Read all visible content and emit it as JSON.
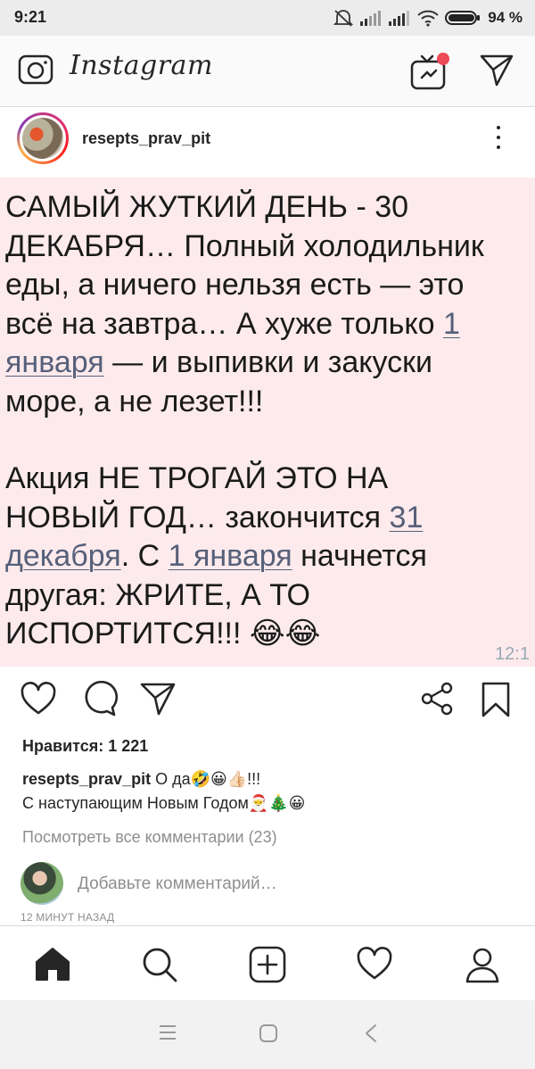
{
  "status_bar": {
    "time": "9:21",
    "battery_percent": "94 %"
  },
  "app": {
    "title": "Instagram"
  },
  "post": {
    "username": "resepts_prav_pit",
    "image_text": {
      "line1": "САМЫЙ ЖУТКИЙ ДЕНЬ - 30",
      "line2": "ДЕКАБРЯ… Полный холодильник",
      "line3": "еды, а ничего нельзя есть — это",
      "line4a": "всё на завтра… А хуже только ",
      "link1a": "1",
      "link1b": "января",
      "line5b": " — и выпивки и закуски",
      "line6": "море, а не лезет!!!",
      "line7": "Акция НЕ ТРОГАЙ ЭТО НА",
      "line8a": "НОВЫЙ ГОД… закончится ",
      "link2a": "31",
      "link2b": "декабря",
      "line9b": ". С ",
      "link3": "1 января",
      "line9c": " начнется",
      "line10": "другая: ЖРИТЕ, А ТО",
      "line11": "ИСПОРТИТСЯ!!! 😂😂",
      "timestamp": "12:1"
    },
    "likes": "Нравится: 1 221",
    "caption_user": "resepts_prav_pit",
    "caption_line1": " О да🤣😀👍🏻!!!",
    "caption_line2": "С наступающим Новым Годом🎅🎄😀",
    "view_comments": "Посмотреть все комментарии (23)",
    "add_comment_placeholder": "Добавьте комментарий…",
    "time_ago": "12 МИНУТ НАЗАД"
  },
  "colors": {
    "post_background": "#fdeaec",
    "link": "#56607a",
    "muted": "#8e8e8e",
    "text": "#262626",
    "notification_dot": "#ed4956"
  },
  "icons": {
    "top_left": "camera-icon",
    "top_right": [
      "igtv-icon",
      "direct-send-icon"
    ],
    "actions": [
      "heart-icon",
      "comment-icon",
      "share-icon",
      "link-share-icon",
      "bookmark-icon"
    ],
    "bottom_nav": [
      "home-icon",
      "search-icon",
      "new-post-icon",
      "activity-heart-icon",
      "profile-icon"
    ],
    "system_nav": [
      "menu-icon",
      "home-square-icon",
      "back-icon"
    ]
  }
}
